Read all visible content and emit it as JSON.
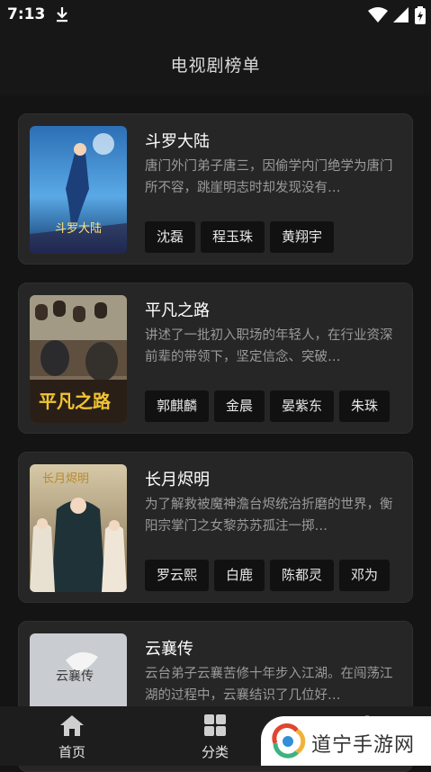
{
  "status_bar": {
    "time": "7:13"
  },
  "header": {
    "title": "电视剧榜单"
  },
  "shows": [
    {
      "title": "斗罗大陆",
      "description": "唐门外门弟子唐三，因偷学内门绝学为唐门所不容，跳崖明志时却发现没有…",
      "cast": [
        "沈磊",
        "程玉珠",
        "黄翔宇"
      ],
      "poster_text": "斗罗大陆"
    },
    {
      "title": "平凡之路",
      "description": "讲述了一批初入职场的年轻人，在行业资深前辈的带领下，坚定信念、突破…",
      "cast": [
        "郭麒麟",
        "金晨",
        "晏紫东",
        "朱珠"
      ],
      "poster_text": "平凡之路"
    },
    {
      "title": "长月烬明",
      "description": "为了解救被魔神澹台烬统治折磨的世界，衡阳宗掌门之女黎苏苏孤注一掷…",
      "cast": [
        "罗云熙",
        "白鹿",
        "陈都灵",
        "邓为"
      ],
      "poster_text": "长月烬明"
    },
    {
      "title": "云襄传",
      "description": "云台弟子云襄苦修十年步入江湖。在闯荡江湖的过程中，云襄结识了几位好…",
      "cast": [],
      "poster_text": "云襄传"
    }
  ],
  "nav": {
    "home": "首页",
    "category": "分类"
  },
  "watermark": {
    "text": "道宁手游网"
  }
}
